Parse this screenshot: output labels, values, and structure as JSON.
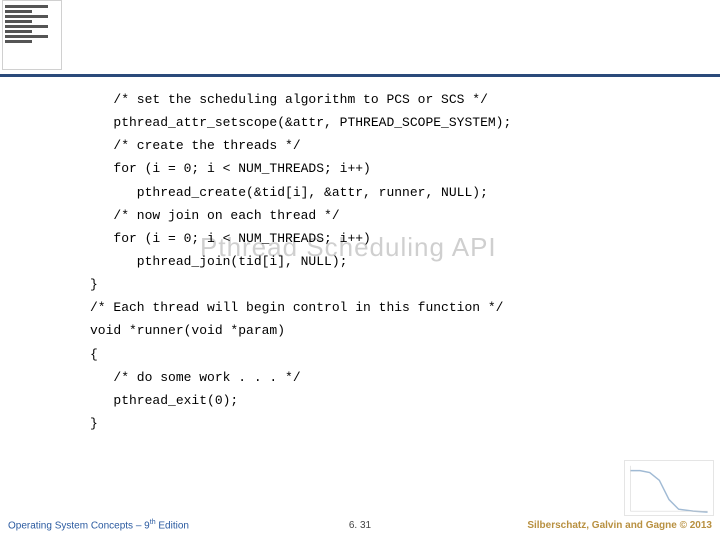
{
  "watermark": "Pthread Scheduling API",
  "code_lines": [
    "   /* set the scheduling algorithm to PCS or SCS */",
    "   pthread_attr_setscope(&attr, PTHREAD_SCOPE_SYSTEM);",
    "   /* create the threads */",
    "   for (i = 0; i < NUM_THREADS; i++)",
    "      pthread_create(&tid[i], &attr, runner, NULL);",
    "   /* now join on each thread */",
    "   for (i = 0; i < NUM_THREADS; i++)",
    "      pthread_join(tid[i], NULL);",
    "}",
    "/* Each thread will begin control in this function */",
    "void *runner(void *param)",
    "{",
    "   /* do some work . . . */",
    "   pthread_exit(0);",
    "}"
  ],
  "footer": {
    "left_prefix": "Operating System Concepts – 9",
    "left_suffix": " Edition",
    "left_sup": "th",
    "center": "6. 31",
    "right": "Silberschatz, Galvin and Gagne © 2013"
  }
}
